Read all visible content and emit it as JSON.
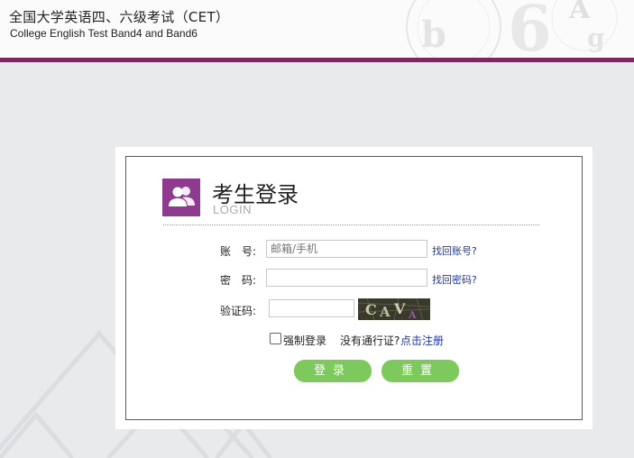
{
  "header": {
    "title_cn": "全国大学英语四、六级考试（CET）",
    "title_en": "College English Test Band4 and Band6",
    "bar_color": "#7b2a5f"
  },
  "login": {
    "icon": "user-group-icon",
    "title": "考生登录",
    "subtitle": "LOGIN",
    "account_label": "账　号:",
    "account_placeholder": "邮箱/手机",
    "find_account_link": "找回账号?",
    "password_label": "密　码:",
    "password_value": "",
    "find_password_link": "找回密码?",
    "captcha_label": "验证码:",
    "captcha_value": "",
    "captcha_text": "CAVA",
    "force_login_label": "强制登录",
    "force_login_checked": false,
    "no_pass_text": "没有通行证?",
    "register_link": "点击注册",
    "login_button": "登录",
    "reset_button": "重置",
    "accent_color": "#8e3a8e",
    "button_color": "#7dc95e",
    "link_color": "#1d35b5"
  }
}
